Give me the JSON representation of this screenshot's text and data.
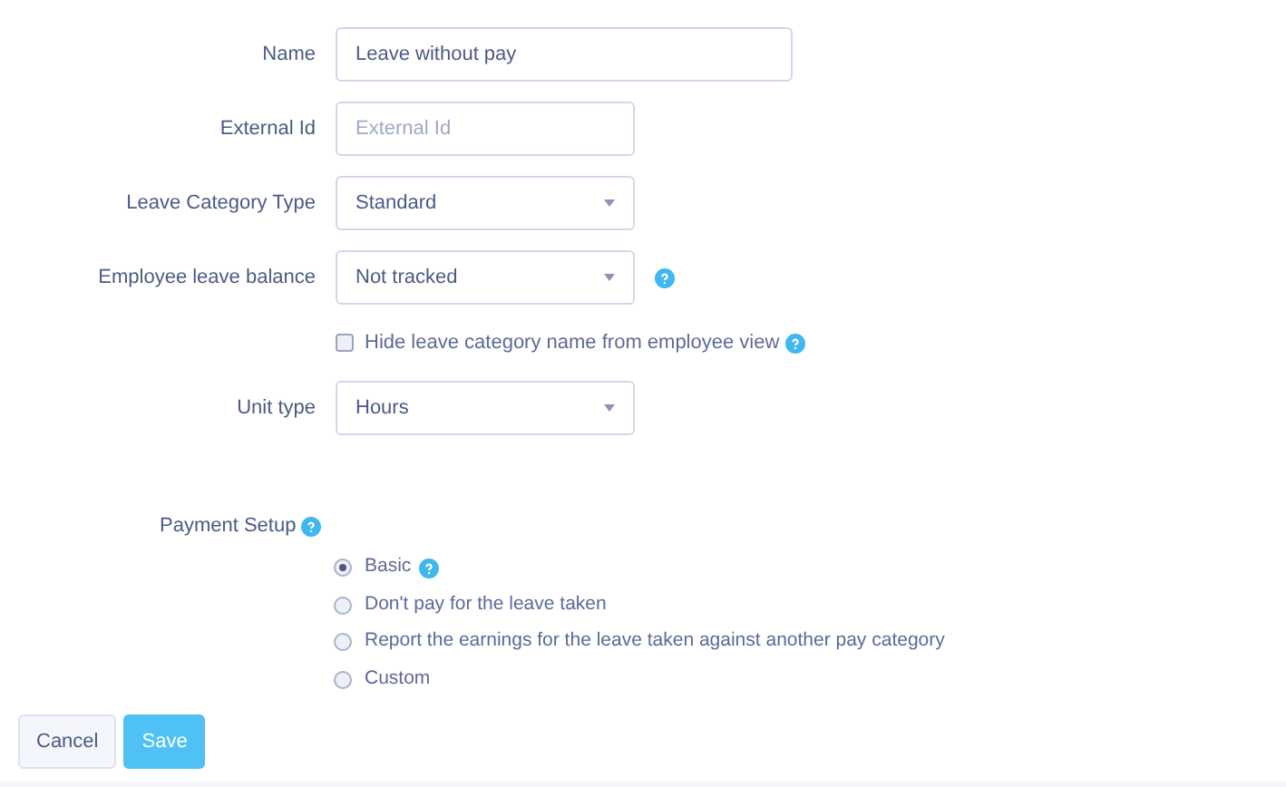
{
  "fields": [
    {
      "kind": "text",
      "label": "Name",
      "value": "Leave without pay",
      "wide": true
    },
    {
      "kind": "text",
      "label": "External Id",
      "placeholder": "External Id"
    },
    {
      "kind": "select",
      "label": "Leave Category Type",
      "value": "Standard"
    },
    {
      "kind": "select",
      "label": "Employee leave balance",
      "value": "Not tracked",
      "help": true
    },
    {
      "kind": "checkbox",
      "label": "Hide leave category name from employee view",
      "checked": false,
      "help": true
    },
    {
      "kind": "select",
      "label": "Unit type",
      "value": "Hours"
    }
  ],
  "payment_setup": {
    "label": "Payment Setup",
    "help": true,
    "options": [
      {
        "label": "Basic",
        "selected": true,
        "help": true
      },
      {
        "label": "Don't pay for the leave taken",
        "selected": false
      },
      {
        "label": "Report the earnings for the leave taken against another pay category",
        "selected": false
      },
      {
        "label": "Custom",
        "selected": false
      }
    ]
  },
  "buttons": [
    {
      "kind": "secondary",
      "label": "Cancel"
    },
    {
      "kind": "primary",
      "label": "Save"
    }
  ]
}
